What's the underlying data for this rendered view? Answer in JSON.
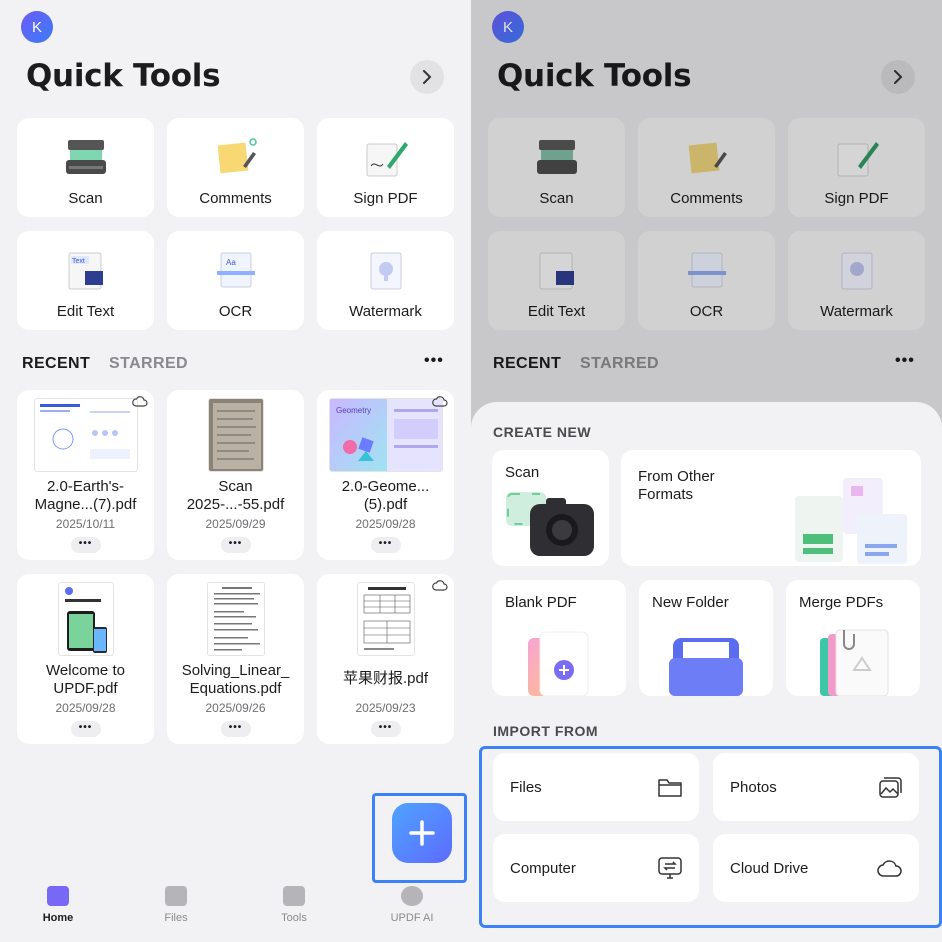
{
  "avatar_letter": "K",
  "title": "Quick Tools",
  "tools": [
    {
      "label": "Scan",
      "icon": "scanner-icon"
    },
    {
      "label": "Comments",
      "icon": "sticky-note-icon"
    },
    {
      "label": "Sign PDF",
      "icon": "signature-icon"
    },
    {
      "label": "Edit Text",
      "icon": "edit-text-icon"
    },
    {
      "label": "OCR",
      "icon": "ocr-icon"
    },
    {
      "label": "Watermark",
      "icon": "watermark-icon"
    }
  ],
  "tabs": {
    "recent": "RECENT",
    "starred": "STARRED",
    "more": "•••"
  },
  "files": [
    {
      "name": "2.0-Earth's-Magne...(7).pdf",
      "date": "2025/10/11",
      "cloud": true
    },
    {
      "name": "Scan 2025-...-55.pdf",
      "date": "2025/09/29",
      "cloud": false
    },
    {
      "name": "2.0-Geome...(5).pdf",
      "date": "2025/09/28",
      "cloud": true,
      "thumb_text": "Geometry"
    },
    {
      "name": "Welcome to UPDF.pdf",
      "date": "2025/09/28",
      "cloud": false
    },
    {
      "name": "Solving_Linear_ Equations.pdf",
      "date": "2025/09/26",
      "cloud": false
    },
    {
      "name": "苹果财报.pdf",
      "date": "2025/09/23",
      "cloud": true
    }
  ],
  "file_more": "•••",
  "nav": [
    {
      "label": "Home",
      "active": true
    },
    {
      "label": "Files",
      "active": false
    },
    {
      "label": "Tools",
      "active": false
    },
    {
      "label": "UPDF AI",
      "active": false
    }
  ],
  "sheet": {
    "create_title": "CREATE NEW",
    "create": [
      {
        "label": "Scan"
      },
      {
        "label": "From Other Formats"
      },
      {
        "label": "Blank PDF"
      },
      {
        "label": "New Folder"
      },
      {
        "label": "Merge PDFs"
      }
    ],
    "import_title": "IMPORT FROM",
    "import": [
      {
        "label": "Files",
        "icon": "folder-icon"
      },
      {
        "label": "Photos",
        "icon": "photos-icon"
      },
      {
        "label": "Computer",
        "icon": "computer-icon"
      },
      {
        "label": "Cloud Drive",
        "icon": "cloud-icon"
      }
    ]
  },
  "colors": {
    "accent": "#3b82f6",
    "brand_purple": "#7868f5"
  }
}
